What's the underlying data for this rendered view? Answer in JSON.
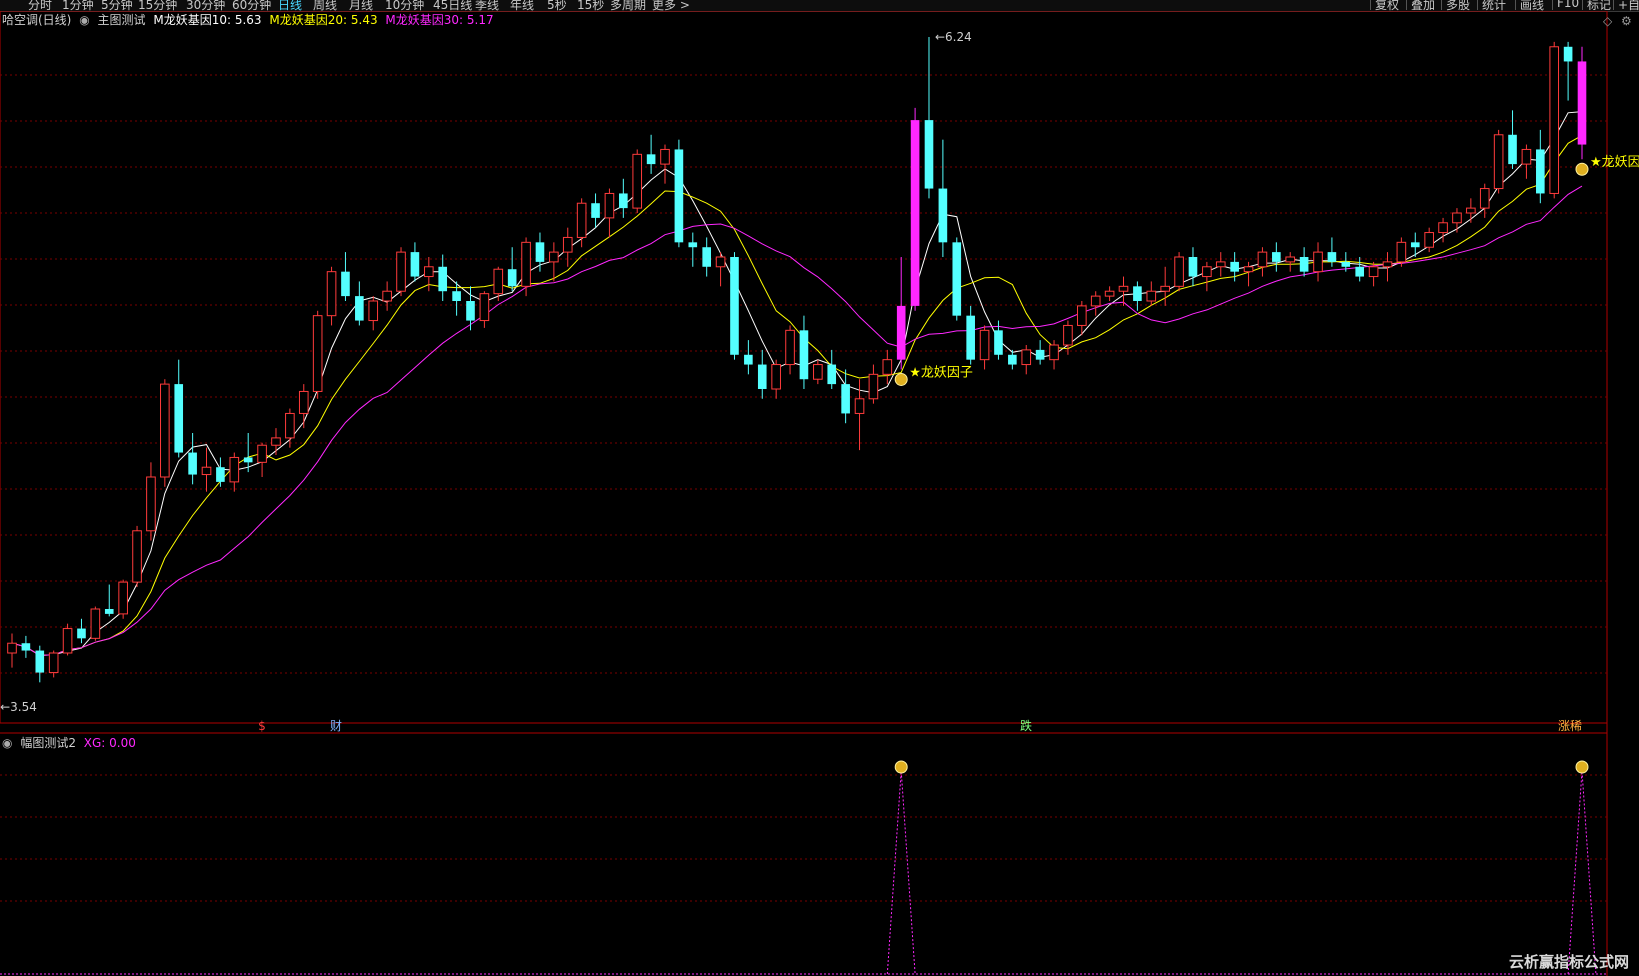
{
  "toolbar": {
    "periods": [
      "分时",
      "1分钟",
      "5分钟",
      "15分钟",
      "30分钟",
      "60分钟",
      "日线",
      "周线",
      "月线",
      "10分钟",
      "45日线",
      "季线",
      "年线",
      "5秒",
      "15秒",
      "多周期",
      "更多 >"
    ],
    "active_period": "日线",
    "right_buttons": [
      "复权",
      "叠加",
      "多股",
      "统计",
      "画线",
      "F10",
      "标记",
      "+自"
    ]
  },
  "main_panel": {
    "stock_name": "哈空调(日线)",
    "indicator_name": "主图测试",
    "ma10_label": "M龙妖基因10: 5.63",
    "ma20_label": "M龙妖基因20: 5.43",
    "ma30_label": "M龙妖基因30: 5.17",
    "high_label": "6.24",
    "low_label": "3.54",
    "signal_label": "★龙妖因子",
    "event_labels": [
      "$",
      "财",
      "跌",
      "涨稀"
    ]
  },
  "sub_panel": {
    "indicator_name": "幅图测试2",
    "xg_label": "XG: 0.00"
  },
  "watermark": "云析赢指标公式网",
  "colors": {
    "up": "#ff3b3b",
    "down": "#54ffff",
    "signal_candle": "#ff28ff",
    "ma10": "#ffffff",
    "ma20": "#ffff00",
    "ma30": "#ff28ff",
    "grid": "#7a0000",
    "active_period": "#49d7ff"
  },
  "chart_data": {
    "type": "candlestick",
    "series_names": [
      "M龙妖基因10",
      "M龙妖基因20",
      "M龙妖基因30"
    ],
    "price_range": [
      3.54,
      6.24
    ],
    "candles_ohlc": [
      [
        3.72,
        3.8,
        3.66,
        3.76
      ],
      [
        3.76,
        3.79,
        3.7,
        3.73
      ],
      [
        3.73,
        3.75,
        3.6,
        3.64
      ],
      [
        3.64,
        3.73,
        3.62,
        3.72
      ],
      [
        3.72,
        3.84,
        3.71,
        3.82
      ],
      [
        3.82,
        3.86,
        3.76,
        3.78
      ],
      [
        3.78,
        3.91,
        3.77,
        3.9
      ],
      [
        3.9,
        4.0,
        3.87,
        3.88
      ],
      [
        3.88,
        4.02,
        3.86,
        4.01
      ],
      [
        4.01,
        4.24,
        3.99,
        4.22
      ],
      [
        4.22,
        4.5,
        4.18,
        4.44
      ],
      [
        4.44,
        4.84,
        4.4,
        4.82
      ],
      [
        4.82,
        4.92,
        4.52,
        4.54
      ],
      [
        4.54,
        4.62,
        4.41,
        4.45
      ],
      [
        4.45,
        4.56,
        4.38,
        4.48
      ],
      [
        4.48,
        4.52,
        4.4,
        4.42
      ],
      [
        4.42,
        4.54,
        4.38,
        4.52
      ],
      [
        4.52,
        4.62,
        4.46,
        4.5
      ],
      [
        4.5,
        4.58,
        4.44,
        4.57
      ],
      [
        4.57,
        4.64,
        4.53,
        4.6
      ],
      [
        4.6,
        4.72,
        4.56,
        4.7
      ],
      [
        4.7,
        4.82,
        4.64,
        4.79
      ],
      [
        4.79,
        5.12,
        4.76,
        5.1
      ],
      [
        5.1,
        5.3,
        5.06,
        5.28
      ],
      [
        5.28,
        5.36,
        5.16,
        5.18
      ],
      [
        5.18,
        5.24,
        5.06,
        5.08
      ],
      [
        5.08,
        5.18,
        5.04,
        5.16
      ],
      [
        5.16,
        5.24,
        5.12,
        5.2
      ],
      [
        5.2,
        5.38,
        5.18,
        5.36
      ],
      [
        5.36,
        5.4,
        5.24,
        5.26
      ],
      [
        5.26,
        5.34,
        5.2,
        5.3
      ],
      [
        5.3,
        5.35,
        5.16,
        5.2
      ],
      [
        5.2,
        5.24,
        5.1,
        5.16
      ],
      [
        5.16,
        5.22,
        5.04,
        5.08
      ],
      [
        5.08,
        5.2,
        5.05,
        5.19
      ],
      [
        5.19,
        5.3,
        5.16,
        5.29
      ],
      [
        5.29,
        5.38,
        5.2,
        5.22
      ],
      [
        5.22,
        5.42,
        5.18,
        5.4
      ],
      [
        5.4,
        5.44,
        5.28,
        5.32
      ],
      [
        5.32,
        5.4,
        5.24,
        5.36
      ],
      [
        5.36,
        5.46,
        5.3,
        5.42
      ],
      [
        5.42,
        5.58,
        5.38,
        5.56
      ],
      [
        5.56,
        5.6,
        5.46,
        5.5
      ],
      [
        5.5,
        5.62,
        5.42,
        5.6
      ],
      [
        5.6,
        5.66,
        5.5,
        5.54
      ],
      [
        5.54,
        5.78,
        5.52,
        5.76
      ],
      [
        5.76,
        5.84,
        5.68,
        5.72
      ],
      [
        5.72,
        5.8,
        5.64,
        5.78
      ],
      [
        5.78,
        5.82,
        5.38,
        5.4
      ],
      [
        5.4,
        5.44,
        5.3,
        5.38
      ],
      [
        5.38,
        5.42,
        5.26,
        5.3
      ],
      [
        5.3,
        5.36,
        5.22,
        5.34
      ],
      [
        5.34,
        5.36,
        4.92,
        4.94
      ],
      [
        4.94,
        5.0,
        4.86,
        4.9
      ],
      [
        4.9,
        4.96,
        4.76,
        4.8
      ],
      [
        4.8,
        4.92,
        4.76,
        4.9
      ],
      [
        4.9,
        5.06,
        4.86,
        5.04
      ],
      [
        5.04,
        5.1,
        4.8,
        4.84
      ],
      [
        4.84,
        4.92,
        4.82,
        4.9
      ],
      [
        4.9,
        4.96,
        4.8,
        4.82
      ],
      [
        4.82,
        4.88,
        4.66,
        4.7
      ],
      [
        4.7,
        4.84,
        4.55,
        4.76
      ],
      [
        4.76,
        4.9,
        4.74,
        4.86
      ],
      [
        4.86,
        4.96,
        4.82,
        4.92
      ],
      [
        4.92,
        5.34,
        4.88,
        5.14
      ],
      [
        5.14,
        5.95,
        5.12,
        5.9
      ],
      [
        5.9,
        6.24,
        5.58,
        5.62
      ],
      [
        5.62,
        5.82,
        5.34,
        5.4
      ],
      [
        5.4,
        5.42,
        5.08,
        5.1
      ],
      [
        5.1,
        5.14,
        4.9,
        4.92
      ],
      [
        4.92,
        5.06,
        4.88,
        5.04
      ],
      [
        5.04,
        5.08,
        4.92,
        4.94
      ],
      [
        4.94,
        4.96,
        4.88,
        4.9
      ],
      [
        4.9,
        4.98,
        4.86,
        4.96
      ],
      [
        4.96,
        5.0,
        4.9,
        4.92
      ],
      [
        4.92,
        5.0,
        4.88,
        4.98
      ],
      [
        4.98,
        5.08,
        4.94,
        5.06
      ],
      [
        5.06,
        5.16,
        5.02,
        5.14
      ],
      [
        5.14,
        5.2,
        5.1,
        5.18
      ],
      [
        5.18,
        5.22,
        5.16,
        5.2
      ],
      [
        5.2,
        5.26,
        5.14,
        5.22
      ],
      [
        5.22,
        5.24,
        5.12,
        5.16
      ],
      [
        5.16,
        5.24,
        5.14,
        5.2
      ],
      [
        5.2,
        5.3,
        5.14,
        5.22
      ],
      [
        5.22,
        5.36,
        5.2,
        5.34
      ],
      [
        5.34,
        5.38,
        5.22,
        5.26
      ],
      [
        5.26,
        5.32,
        5.2,
        5.3
      ],
      [
        5.3,
        5.36,
        5.26,
        5.32
      ],
      [
        5.32,
        5.36,
        5.24,
        5.28
      ],
      [
        5.28,
        5.32,
        5.22,
        5.3
      ],
      [
        5.3,
        5.38,
        5.26,
        5.36
      ],
      [
        5.36,
        5.4,
        5.28,
        5.32
      ],
      [
        5.32,
        5.36,
        5.28,
        5.34
      ],
      [
        5.34,
        5.38,
        5.26,
        5.28
      ],
      [
        5.28,
        5.4,
        5.24,
        5.36
      ],
      [
        5.36,
        5.42,
        5.3,
        5.32
      ],
      [
        5.32,
        5.36,
        5.28,
        5.3
      ],
      [
        5.3,
        5.34,
        5.24,
        5.26
      ],
      [
        5.26,
        5.32,
        5.22,
        5.3
      ],
      [
        5.3,
        5.36,
        5.24,
        5.32
      ],
      [
        5.32,
        5.42,
        5.3,
        5.4
      ],
      [
        5.4,
        5.44,
        5.34,
        5.38
      ],
      [
        5.38,
        5.46,
        5.36,
        5.44
      ],
      [
        5.44,
        5.5,
        5.4,
        5.48
      ],
      [
        5.48,
        5.54,
        5.44,
        5.52
      ],
      [
        5.52,
        5.58,
        5.48,
        5.54
      ],
      [
        5.54,
        5.64,
        5.5,
        5.62
      ],
      [
        5.62,
        5.86,
        5.6,
        5.84
      ],
      [
        5.84,
        5.94,
        5.7,
        5.72
      ],
      [
        5.72,
        5.8,
        5.66,
        5.78
      ],
      [
        5.78,
        5.86,
        5.56,
        5.6
      ],
      [
        5.6,
        6.22,
        5.58,
        6.2
      ],
      [
        6.2,
        6.22,
        5.98,
        6.14
      ],
      [
        6.14,
        6.2,
        5.74,
        5.8
      ]
    ],
    "signal_candle_indices": [
      64,
      65,
      113,
      114
    ],
    "signal_marker_indices": [
      64,
      113
    ],
    "sub_indicator": {
      "name": "XG",
      "spike_indices": [
        64,
        113
      ],
      "values_range": [
        0,
        1
      ]
    }
  }
}
